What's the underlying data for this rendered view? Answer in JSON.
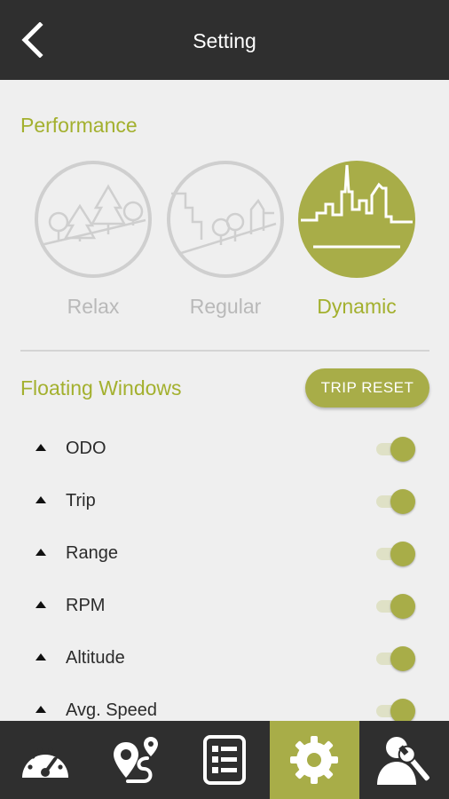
{
  "header": {
    "title": "Setting"
  },
  "performance": {
    "title": "Performance",
    "modes": [
      {
        "label": "Relax",
        "icon": "trees-icon",
        "active": false
      },
      {
        "label": "Regular",
        "icon": "suburb-icon",
        "active": false
      },
      {
        "label": "Dynamic",
        "icon": "city-skyline-icon",
        "active": true
      }
    ]
  },
  "floating_windows": {
    "title": "Floating Windows",
    "trip_reset_label": "TRIP RESET",
    "items": [
      {
        "label": "ODO",
        "enabled": true
      },
      {
        "label": "Trip",
        "enabled": true
      },
      {
        "label": "Range",
        "enabled": true
      },
      {
        "label": "RPM",
        "enabled": true
      },
      {
        "label": "Altitude",
        "enabled": true
      },
      {
        "label": "Avg. Speed",
        "enabled": true
      }
    ]
  },
  "bottom_nav": {
    "items": [
      {
        "icon": "speedometer-icon",
        "active": false
      },
      {
        "icon": "route-pin-icon",
        "active": false
      },
      {
        "icon": "report-list-icon",
        "active": false
      },
      {
        "icon": "gear-icon",
        "active": true
      },
      {
        "icon": "user-wrench-icon",
        "active": false
      }
    ]
  },
  "colors": {
    "accent": "#a8ad48",
    "accent_text": "#a3b02e",
    "bar": "#2f2f2f",
    "background": "#efefef"
  }
}
